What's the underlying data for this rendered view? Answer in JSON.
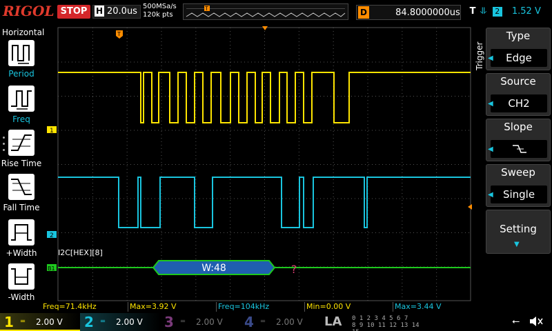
{
  "brand": {
    "logo": "RIGOL"
  },
  "topbar": {
    "run_state": "STOP",
    "timebase_prefix": "H",
    "timebase_value": "20.0us",
    "sample_rate": "500MSa/s",
    "memory_depth": "120k pts",
    "delay_prefix": "D",
    "delay_value": "84.8000000us",
    "trigger_prefix": "T",
    "trigger_channel": "2",
    "trigger_level": "1.52 V"
  },
  "left_menu": {
    "title": "Horizontal",
    "items": [
      {
        "label": "Period",
        "icon": "period-measure-icon"
      },
      {
        "label": "Freq",
        "icon": "frequency-measure-icon"
      },
      {
        "label": "Rise Time",
        "icon": "rise-time-icon"
      },
      {
        "label": "Fall Time",
        "icon": "fall-time-icon"
      },
      {
        "label": "+Width",
        "icon": "positive-width-icon"
      },
      {
        "label": "-Width",
        "icon": "negative-width-icon"
      }
    ]
  },
  "waveform": {
    "ch1_marker": "1",
    "ch2_marker": "2",
    "bus_marker": "B1",
    "trigger_marker": "T",
    "decoder_label": "I2C[HEX][8]",
    "decode_packet": "W:48",
    "decode_unknown": "?"
  },
  "right_menu": {
    "tab": "Trigger",
    "items": [
      {
        "title": "Type",
        "value": "Edge"
      },
      {
        "title": "Source",
        "value": "CH2"
      },
      {
        "title": "Slope",
        "value": ""
      },
      {
        "title": "Sweep",
        "value": "Single"
      },
      {
        "title": "Setting",
        "value": ""
      }
    ]
  },
  "measurements": [
    {
      "text": "Freq=71.4kHz",
      "channel": 1
    },
    {
      "text": "Max=3.92 V",
      "channel": 1
    },
    {
      "text": "Freq=104kHz",
      "channel": 2
    },
    {
      "text": "Min=0.00 V",
      "channel": 1
    },
    {
      "text": "Max=3.44 V",
      "channel": 2
    }
  ],
  "channels": [
    {
      "num": "1",
      "scale": "2.00 V",
      "color": "#ffe500",
      "active": true
    },
    {
      "num": "2",
      "scale": "2.00 V",
      "color": "#19c5df",
      "active": true
    },
    {
      "num": "3",
      "scale": "2.00 V",
      "color": "#7a3a7a",
      "active": false
    },
    {
      "num": "4",
      "scale": "2.00 V",
      "color": "#3a4a8a",
      "active": false
    }
  ],
  "logic_analyzer": {
    "label": "LA",
    "row1": "0 1 2 3  4 5 6 7",
    "row2": "8 9 10 11  12 13 14 15"
  },
  "colors": {
    "ch1": "#ffe500",
    "ch2": "#19c5df",
    "bus": "#1ec81e",
    "accent": "#ff8c00",
    "stop": "#d4272a"
  }
}
